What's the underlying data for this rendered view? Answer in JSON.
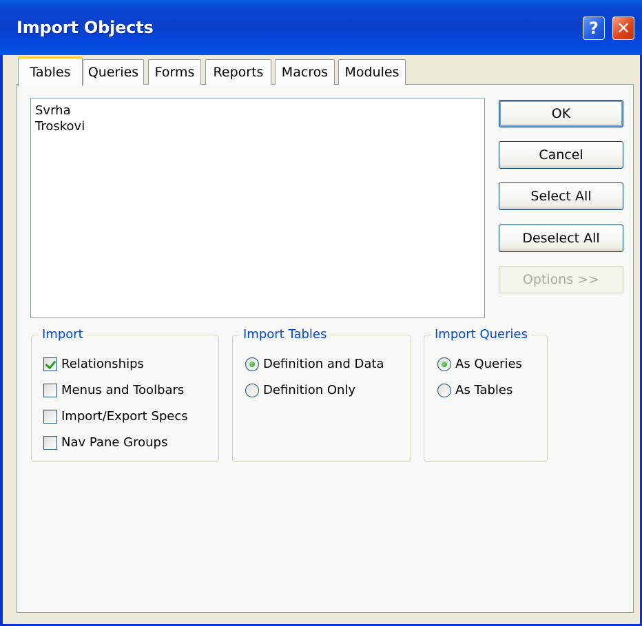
{
  "window": {
    "title": "Import Objects"
  },
  "tabs": [
    "Tables",
    "Queries",
    "Forms",
    "Reports",
    "Macros",
    "Modules"
  ],
  "list": {
    "items": [
      "Svrha",
      "Troskovi"
    ]
  },
  "buttons": {
    "ok": "OK",
    "cancel": "Cancel",
    "select_all": "Select All",
    "deselect_all": "Deselect All",
    "options": "Options >>"
  },
  "import_group": {
    "legend": "Import",
    "options": [
      {
        "label": "Relationships",
        "checked": true
      },
      {
        "label": "Menus and Toolbars",
        "checked": false
      },
      {
        "label": "Import/Export Specs",
        "checked": false
      },
      {
        "label": "Nav Pane Groups",
        "checked": false
      }
    ]
  },
  "import_tables_group": {
    "legend": "Import Tables",
    "options": [
      {
        "label": "Definition and Data",
        "selected": true
      },
      {
        "label": "Definition Only",
        "selected": false
      }
    ]
  },
  "import_queries_group": {
    "legend": "Import Queries",
    "options": [
      {
        "label": "As Queries",
        "selected": true
      },
      {
        "label": "As Tables",
        "selected": false
      }
    ]
  },
  "icons": {
    "help": "help-icon",
    "close": "close-icon"
  }
}
